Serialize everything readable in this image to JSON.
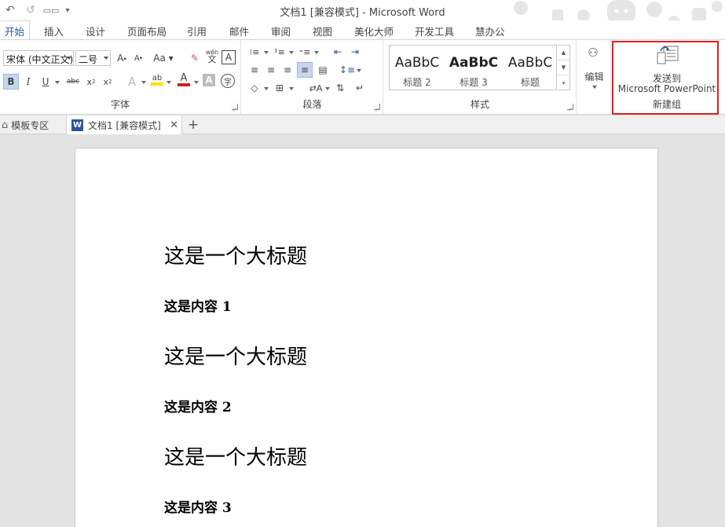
{
  "window": {
    "title": "文档1 [兼容模式] - Microsoft Word"
  },
  "tabs": [
    "开始",
    "插入",
    "设计",
    "页面布局",
    "引用",
    "邮件",
    "审阅",
    "视图",
    "美化大师",
    "开发工具",
    "慧办公"
  ],
  "font_group": {
    "font_name": "宋体 (中文正文)",
    "font_size": "二号",
    "phonetic_label": "wén",
    "label": "字体"
  },
  "paragraph_group": {
    "label": "段落"
  },
  "styles_group": {
    "label": "样式",
    "items": [
      {
        "sample": "AaBbC",
        "name": "标题 2"
      },
      {
        "sample": "AaBbC",
        "name": "标题 3"
      },
      {
        "sample": "AaBbC",
        "name": "标题"
      }
    ]
  },
  "editing_group": {
    "label": "编辑"
  },
  "new_group": {
    "button_line1": "发送到",
    "button_line2": "Microsoft PowerPoint",
    "label": "新建组"
  },
  "doc_tabs": {
    "template_zone": "模板专区",
    "document": "文档1 [兼容模式]"
  },
  "document": {
    "blocks": [
      {
        "type": "heading",
        "text": "这是一个大标题"
      },
      {
        "type": "body",
        "text": "这是内容 1"
      },
      {
        "type": "heading",
        "text": "这是一个大标题"
      },
      {
        "type": "body",
        "text": "这是内容 2"
      },
      {
        "type": "heading",
        "text": "这是一个大标题"
      },
      {
        "type": "body",
        "text": "这是内容 3"
      }
    ]
  },
  "colors": {
    "accent": "#2b579a",
    "highlight_box": "#e02020",
    "font_color": "#d42020",
    "highlight_color": "#f7e30a"
  }
}
